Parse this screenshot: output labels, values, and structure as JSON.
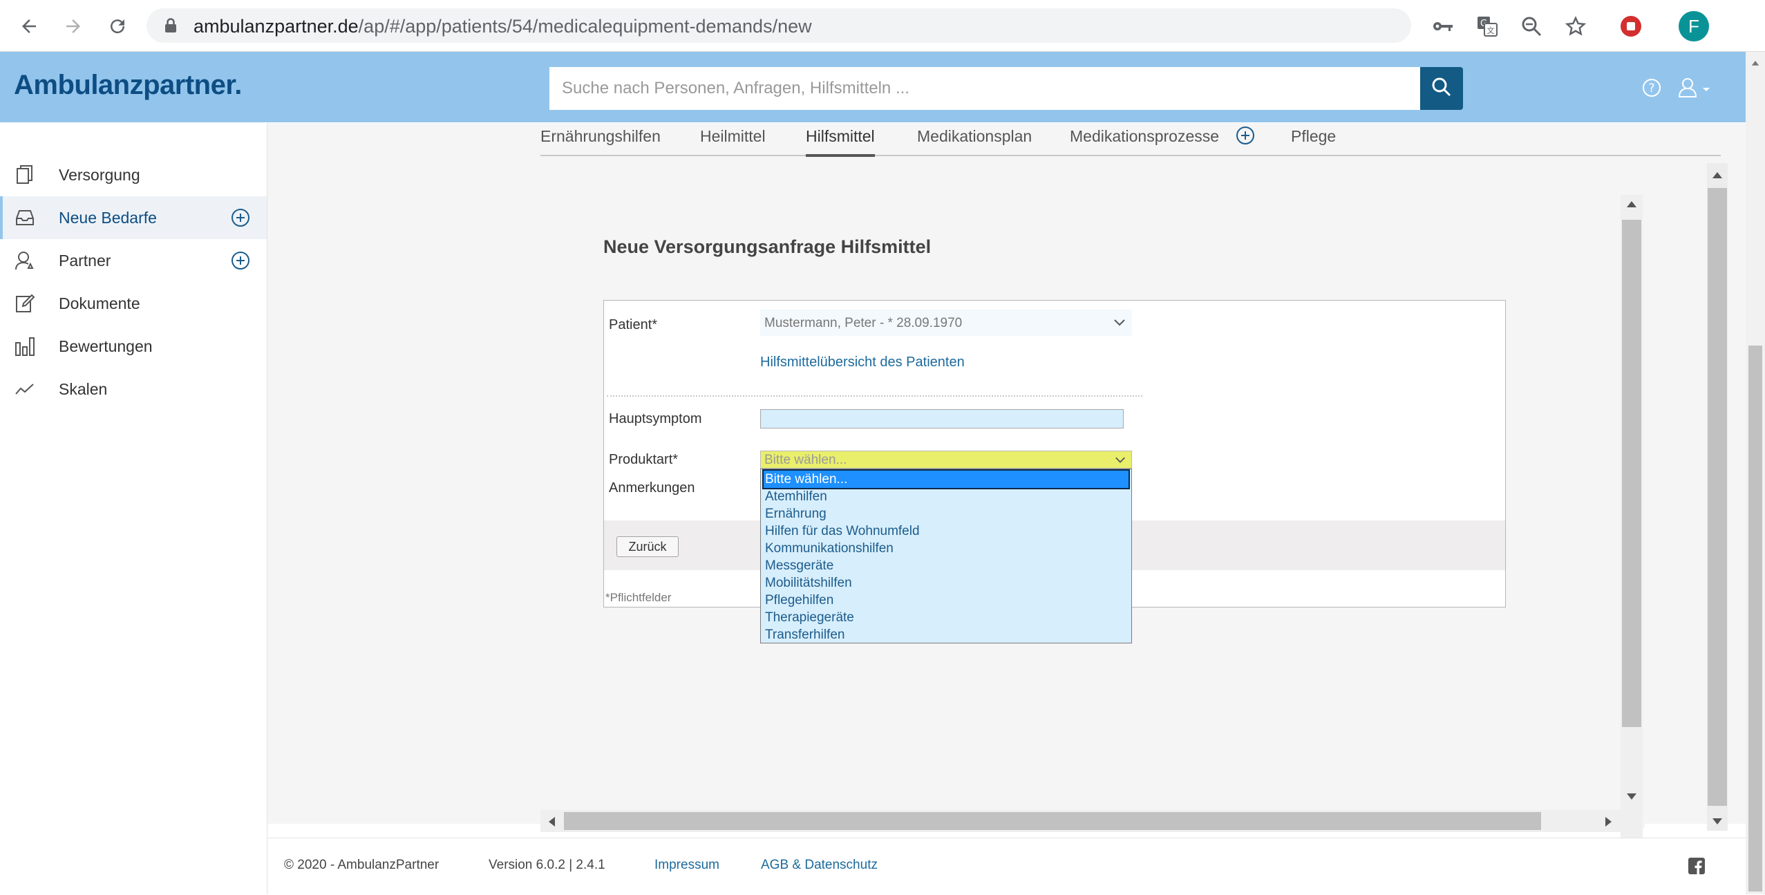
{
  "browser": {
    "url_host": "ambulanzpartner.de",
    "url_path": "/ap/#/app/patients/54/medicalequipment-demands/new",
    "profile_initial": "F"
  },
  "header": {
    "logo": "Ambulanzpartner.",
    "search_placeholder": "Suche nach Personen, Anfragen, Hilfsmitteln ..."
  },
  "sidebar": {
    "items": [
      {
        "label": "Versorgung"
      },
      {
        "label": "Neue Bedarfe"
      },
      {
        "label": "Partner"
      },
      {
        "label": "Dokumente"
      },
      {
        "label": "Bewertungen"
      },
      {
        "label": "Skalen"
      }
    ]
  },
  "tabs": [
    {
      "label": "Ernährungshilfen"
    },
    {
      "label": "Heilmittel"
    },
    {
      "label": "Hilfsmittel"
    },
    {
      "label": "Medikationsplan"
    },
    {
      "label": "Medikationsprozesse"
    },
    {
      "label": "Pflege"
    }
  ],
  "form": {
    "title": "Neue Versorgungsanfrage Hilfsmittel",
    "patient_label": "Patient*",
    "patient_value": "Mustermann, Peter - * 28.09.1970",
    "overview_link": "Hilfsmittelübersicht des Patienten",
    "main_symptom_label": "Hauptsymptom",
    "main_symptom_value": "",
    "product_type_label": "Produktart*",
    "product_type_value": "Bitte wählen...",
    "remarks_label": "Anmerkungen",
    "back_button": "Zurück",
    "required_note": "*Pflichtfelder"
  },
  "product_options": [
    "Bitte wählen...",
    "Atemhilfen",
    "Ernährung",
    "Hilfen für das Wohnumfeld",
    "Kommunikationshilfen",
    "Messgeräte",
    "Mobilitätshilfen",
    "Pflegehilfen",
    "Therapiegeräte",
    "Transferhilfen"
  ],
  "footer": {
    "copyright": "© 2020 - AmbulanzPartner",
    "version": "Version 6.0.2 | 2.4.1",
    "impressum": "Impressum",
    "agb": "AGB & Datenschutz"
  },
  "colors": {
    "header_bg": "#93c5ec",
    "logo": "#0d4d83",
    "search_button": "#135a85",
    "link": "#1c6a9c",
    "select_highlight": "#e9ef6a",
    "dropdown_bg": "#d7eefc",
    "dropdown_selected": "#1e90ff"
  }
}
